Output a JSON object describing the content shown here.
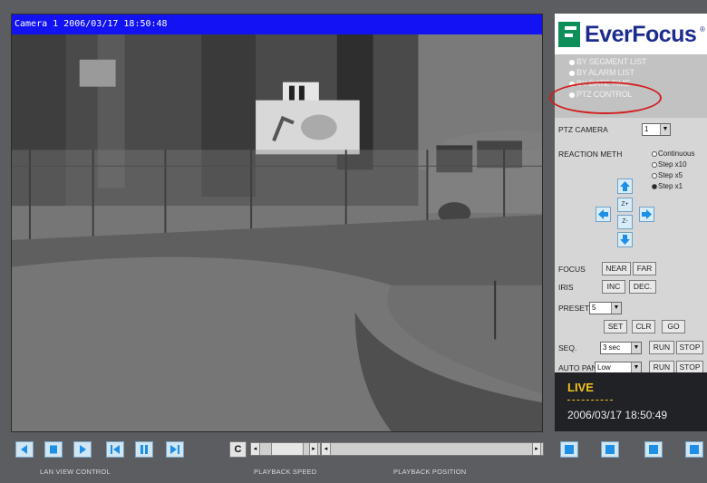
{
  "video": {
    "title": "Camera 1 2006/03/17 18:50:48"
  },
  "logo": {
    "text": "EverFocus",
    "reg": "®"
  },
  "menu": [
    {
      "label": "BY SEGMENT LIST"
    },
    {
      "label": "BY ALARM LIST"
    },
    {
      "label": "BY DATE TIME"
    },
    {
      "label": "PTZ CONTROL"
    }
  ],
  "ptz": {
    "camera_label": "PTZ CAMERA",
    "camera_value": "1",
    "reaction_label": "REACTION METH",
    "reaction_options": [
      "Continuous",
      "Step x10",
      "Step x5",
      "Step x1"
    ],
    "reaction_selected": "Step x1",
    "zoom_in": "Z+",
    "zoom_out": "Z-",
    "focus_label": "FOCUS",
    "near": "NEAR",
    "far": "FAR",
    "iris_label": "IRIS",
    "inc": "INC",
    "dec": "DEC.",
    "preset_label": "PRESET",
    "preset_value": "5",
    "set": "SET",
    "clr": "CLR",
    "go": "GO",
    "seq_label": "SEQ.",
    "seq_value": "3 sec",
    "run": "RUN",
    "stop": "STOP",
    "autopan_label": "AUTO PAN",
    "autopan_value": "Low"
  },
  "live": {
    "label": "LIVE",
    "datetime": "2006/03/17  18:50:49"
  },
  "bottom": {
    "clear": "C",
    "lan_view_control": "LAN VIEW CONTROL",
    "playback_speed": "PLAYBACK SPEED",
    "playback_position": "PLAYBACK POSITION"
  },
  "colors": {
    "title_bar": "#1212f2",
    "live_text": "#f2c21a",
    "highlight_circle": "#d21f1f",
    "button_blue": "#1d8fe6"
  }
}
